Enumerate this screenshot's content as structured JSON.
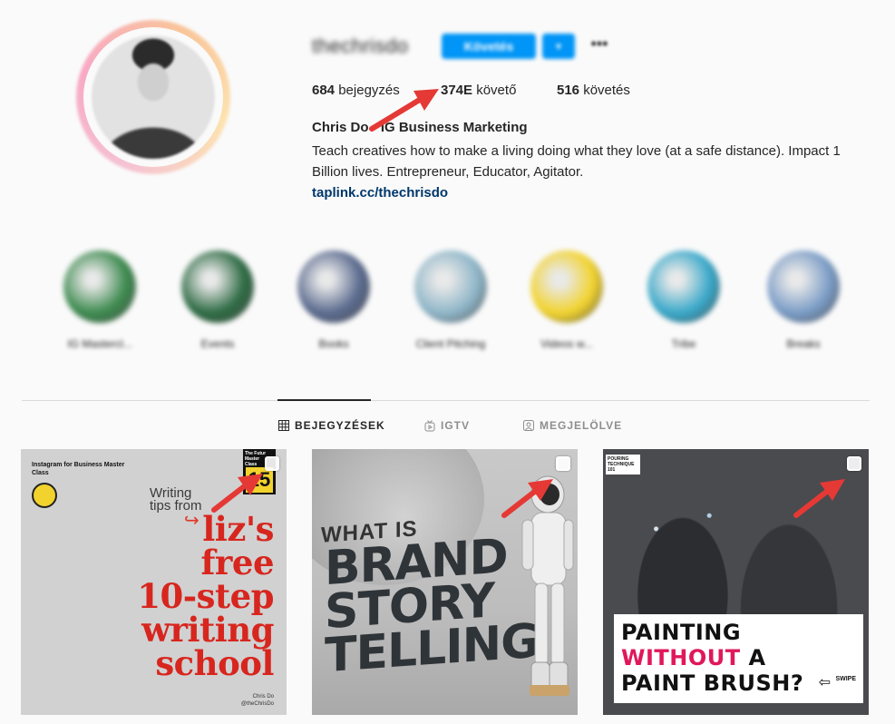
{
  "profile": {
    "username": "thechrisdo",
    "follow_label": "Követés",
    "dropdown_label": "▾",
    "more_label": "•••",
    "stats": {
      "posts_count": "684",
      "posts_label": "bejegyzés",
      "followers_count": "374E",
      "followers_label": "követő",
      "following_count": "516",
      "following_label": "követés"
    },
    "full_name": "Chris Do - IG Business Marketing",
    "bio": "Teach creatives how to make a living doing what they love (at a safe distance). Impact 1 Billion lives. Entrepreneur, Educator, Agitator.",
    "link": "taplink.cc/thechrisdo"
  },
  "highlights": [
    {
      "label": "IG Mastercl...",
      "color": "#3d8a4f"
    },
    {
      "label": "Events",
      "color": "#2e6b44"
    },
    {
      "label": "Books",
      "color": "#5b6b8f"
    },
    {
      "label": "Client Pitching",
      "color": "#8fb6c8"
    },
    {
      "label": "Videos w...",
      "color": "#f2d32e"
    },
    {
      "label": "Tribe",
      "color": "#39a8c9"
    },
    {
      "label": "Breaks",
      "color": "#7a9cc6"
    }
  ],
  "tabs": {
    "posts": "BEJEGYZÉSEK",
    "igtv": "IGTV",
    "tagged": "MEGJELÖLVE"
  },
  "posts": {
    "post1": {
      "header": "Instagram for Business Master Class",
      "badge_text": "The Futur Master Class",
      "badge_num": "15",
      "writing": "Writing tips from",
      "title_lines": [
        "liz's",
        "free",
        "10-step",
        "writing",
        "school"
      ],
      "footer": "Chris Do @theChrisDo"
    },
    "post2": {
      "what_is": "WHAT IS",
      "title_lines": [
        "BRAND",
        "STORY",
        "TELLING"
      ]
    },
    "post3": {
      "tag": "POURING TECHNIQUE 101",
      "line1": "PAINTING",
      "line2_red": "WITHOUT",
      "line2_rest": " A",
      "line3": "PAINT BRUSH?",
      "swipe": "SWIPE"
    }
  },
  "colors": {
    "accent": "#0095f6",
    "annotation_arrow": "#e53935",
    "link": "#00376b"
  }
}
